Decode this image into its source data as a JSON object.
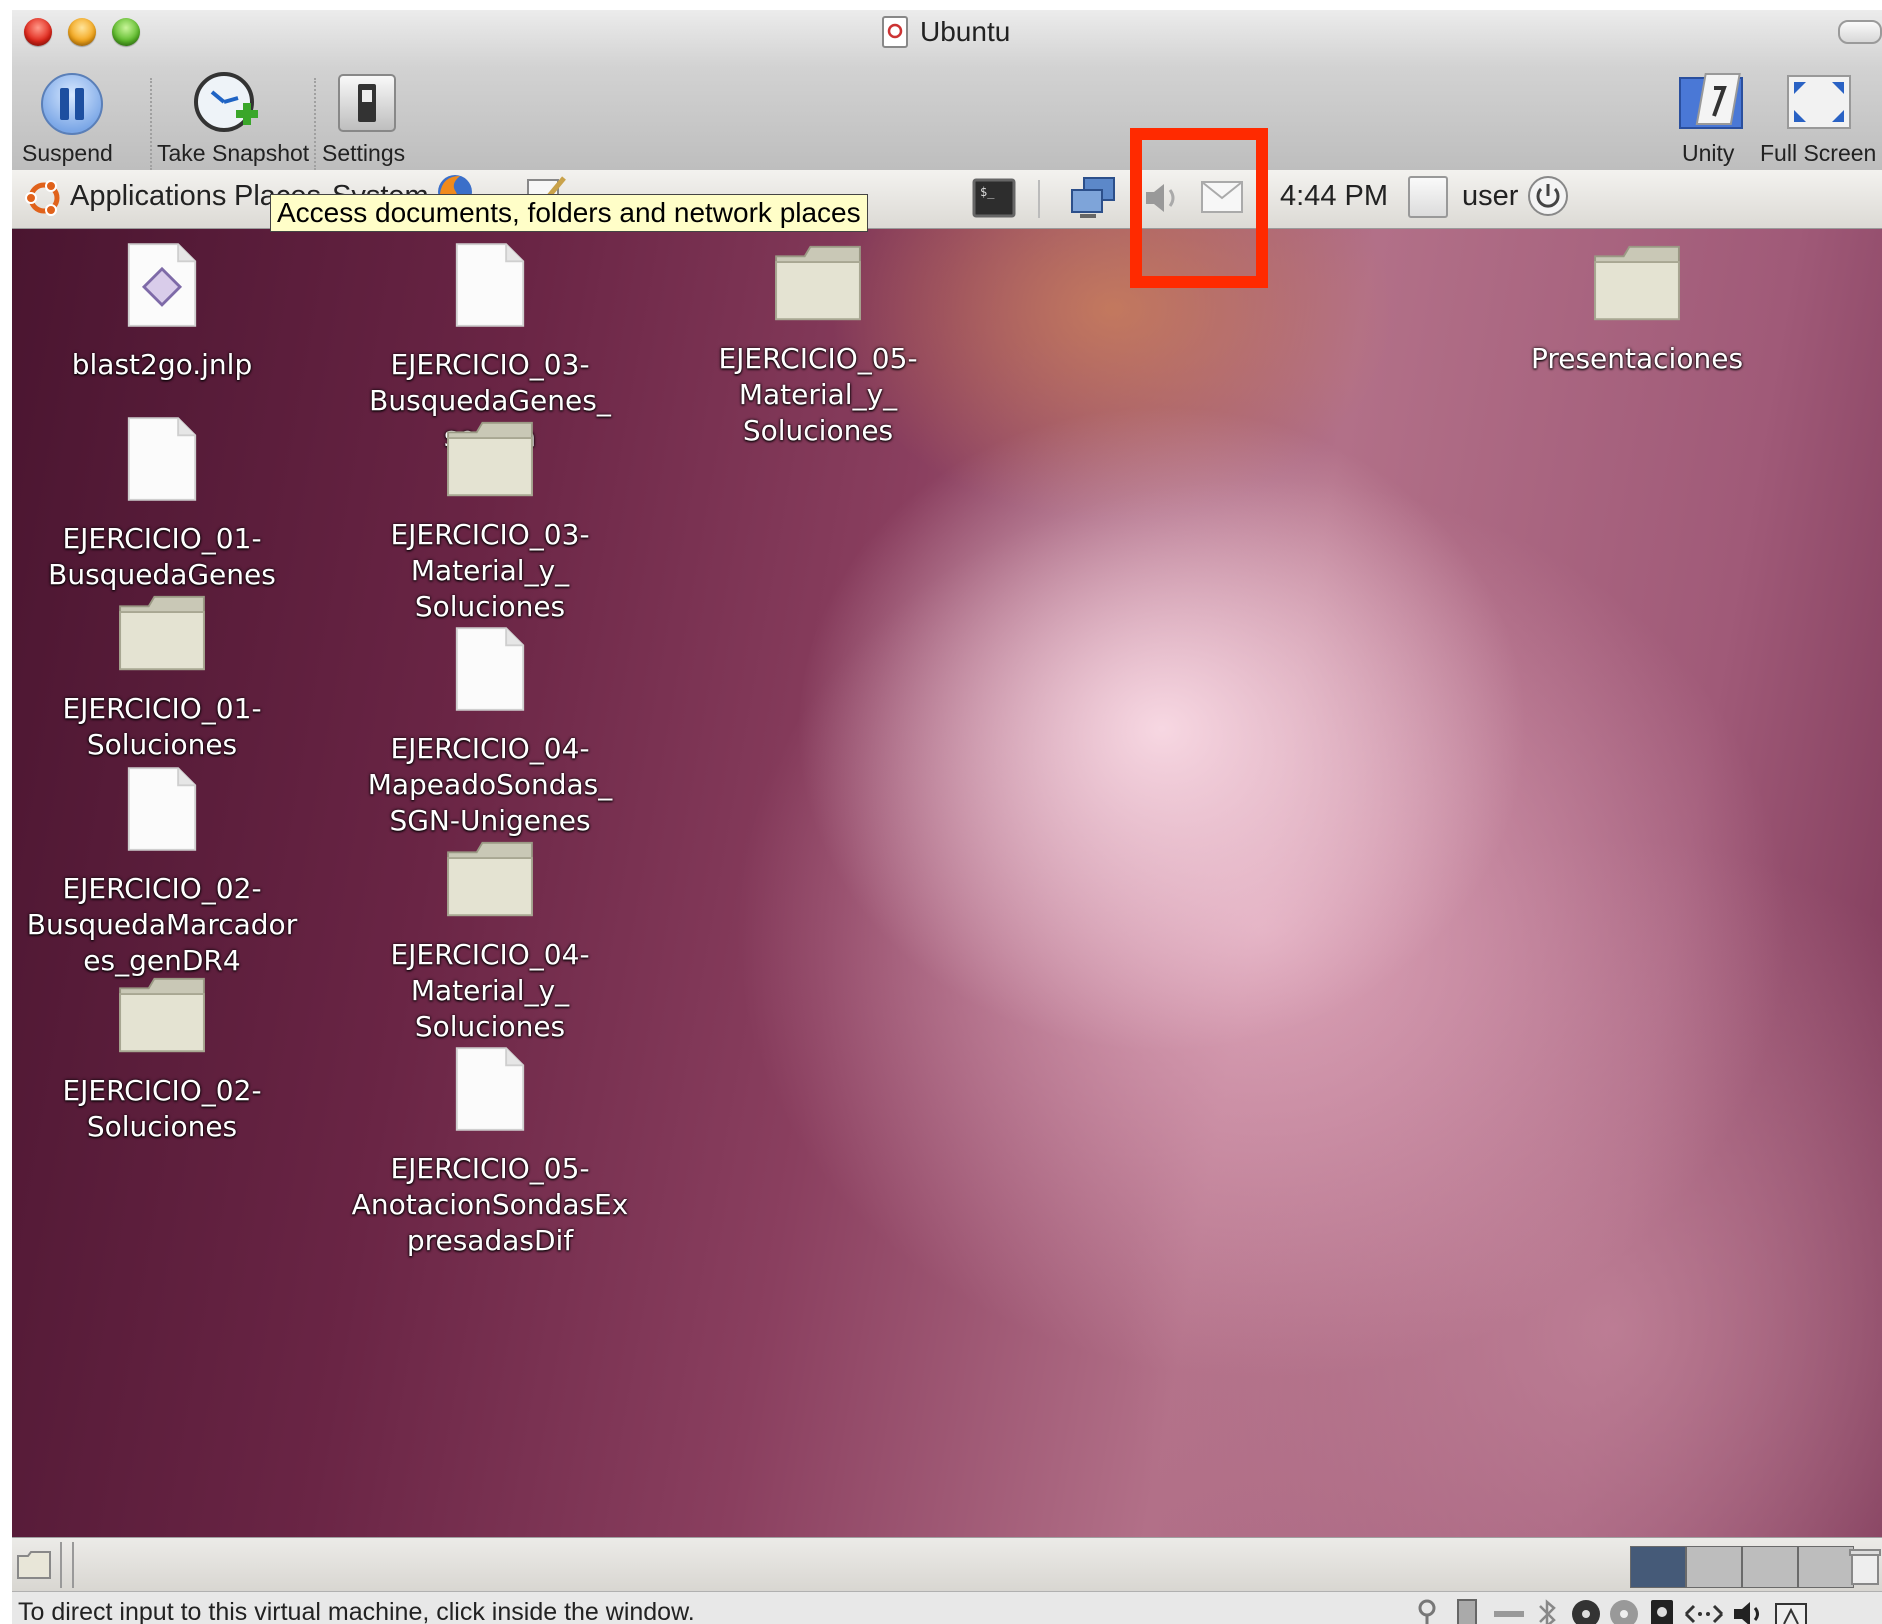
{
  "window": {
    "title": "Ubuntu"
  },
  "toolbar": {
    "suspend_label": "Suspend",
    "snapshot_label": "Take Snapshot",
    "settings_label": "Settings",
    "unity_label": "Unity",
    "fullscreen_label": "Full Screen"
  },
  "panel": {
    "applications_label": "Applications",
    "places_label": "Places",
    "system_label": "System",
    "clock": "4:44 PM",
    "user_label": "user",
    "tooltip": "Access documents, folders and network places"
  },
  "desktop_icons": [
    {
      "label": "blast2go.jnlp",
      "type": "jnlp-file-icon"
    },
    {
      "label": "EJERCICIO_01-\nBusquedaGenes",
      "type": "file-icon"
    },
    {
      "label": "EJERCICIO_01-\nSoluciones",
      "type": "folder-icon"
    },
    {
      "label": "EJERCICIO_02-\nBusquedaMarcador\nes_genDR4",
      "type": "file-icon"
    },
    {
      "label": "EJERCICIO_02-\nSoluciones",
      "type": "folder-icon"
    },
    {
      "label": "EJERCICIO_03-\nBusquedaGenes_\nsequia",
      "type": "file-icon"
    },
    {
      "label": "EJERCICIO_03-\nMaterial_y_\nSoluciones",
      "type": "folder-icon"
    },
    {
      "label": "EJERCICIO_04-\nMapeadoSondas_\nSGN-Unigenes",
      "type": "file-icon"
    },
    {
      "label": "EJERCICIO_04-\nMaterial_y_\nSoluciones",
      "type": "folder-icon"
    },
    {
      "label": "EJERCICIO_05-\nAnotacionSondasEx\npresadasDif",
      "type": "file-icon"
    },
    {
      "label": "EJERCICIO_05-\nMaterial_y_\nSoluciones",
      "type": "folder-icon"
    },
    {
      "label": "Presentaciones",
      "type": "folder-icon"
    }
  ],
  "statusbar": {
    "message": "To direct input to this virtual machine, click inside the window."
  }
}
